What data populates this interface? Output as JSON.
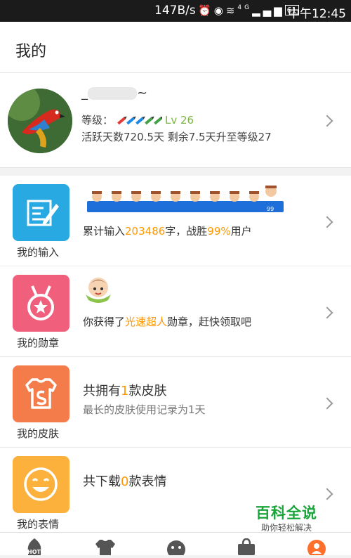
{
  "status_bar": {
    "speed": "147B/s",
    "network": "4G",
    "battery": "61",
    "time": "中午12:45"
  },
  "header": {
    "title": "我的"
  },
  "profile": {
    "username_prefix": "_",
    "username_suffix": "~",
    "level_label": "等级：",
    "level_value": "Lv 26",
    "active_text": "活跃天数720.5天 剩余7.5天升至等级27"
  },
  "cards": {
    "input": {
      "label": "我的输入",
      "text_before": "累计输入",
      "count": "203486",
      "text_mid": "字，战胜",
      "percent": "99%",
      "text_after": "用户",
      "rank_badge": "99"
    },
    "medal": {
      "label": "我的勋章",
      "text_before": "你获得了",
      "medal_name": "光速超人",
      "text_after": "勋章，赶快领取吧"
    },
    "skin": {
      "label": "我的皮肤",
      "text_before": "共拥有",
      "count": "1",
      "text_after": "款皮肤",
      "sub": "最长的皮肤使用记录为1天"
    },
    "emoji": {
      "label": "我的表情",
      "text_before": "共下载",
      "count": "0",
      "text_after": "款表情"
    }
  },
  "watermark": {
    "title": "百科全说",
    "subtitle": "助你轻松解决"
  },
  "navbar": {
    "hot_label": "HOT"
  },
  "colors": {
    "accent_orange": "#ff9800",
    "level_green": "#7cb342",
    "input_blue": "#29a9e1",
    "medal_pink": "#f0607d",
    "skin_orange": "#f47c4a",
    "emoji_yellow": "#fbb13c"
  }
}
